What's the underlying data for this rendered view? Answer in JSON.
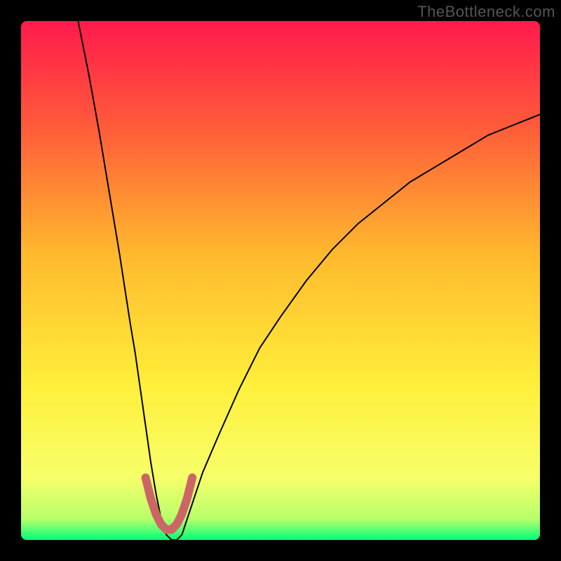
{
  "attribution": "TheBottleneck.com",
  "chart_data": {
    "type": "line",
    "title": "",
    "xlabel": "",
    "ylabel": "",
    "xlim": [
      0,
      100
    ],
    "ylim": [
      0,
      100
    ],
    "gradient_stops": [
      {
        "offset": 0.0,
        "color": "#ff1a4d"
      },
      {
        "offset": 0.2,
        "color": "#ff5a3a"
      },
      {
        "offset": 0.45,
        "color": "#ffb92e"
      },
      {
        "offset": 0.7,
        "color": "#ffef3a"
      },
      {
        "offset": 0.88,
        "color": "#f7ff6a"
      },
      {
        "offset": 0.96,
        "color": "#b6ff6a"
      },
      {
        "offset": 1.0,
        "color": "#00ff7a"
      }
    ],
    "series": [
      {
        "name": "bottleneck-curve-black",
        "color": "#000000",
        "width": 2,
        "x": [
          11,
          13,
          15,
          17,
          19,
          21,
          22,
          23,
          24,
          25,
          26,
          27,
          28,
          29,
          30,
          31,
          32,
          33,
          35,
          38,
          42,
          46,
          50,
          55,
          60,
          65,
          70,
          75,
          80,
          85,
          90,
          95,
          100
        ],
        "y": [
          100,
          90,
          79,
          67,
          55,
          42,
          36,
          29,
          22,
          15,
          9,
          4,
          1,
          0,
          0,
          1,
          4,
          7,
          13,
          20,
          29,
          37,
          43,
          50,
          56,
          61,
          65,
          69,
          72,
          75,
          78,
          80,
          82
        ]
      },
      {
        "name": "bottleneck-curve-highlight",
        "color": "#cc6666",
        "width": 12,
        "x": [
          24.0,
          25.0,
          26.0,
          27.0,
          28.0,
          29.0,
          30.0,
          31.0,
          32.0,
          33.0
        ],
        "y": [
          12.0,
          8.0,
          5.0,
          3.0,
          2.0,
          2.0,
          3.0,
          5.0,
          8.0,
          12.0
        ]
      }
    ]
  }
}
